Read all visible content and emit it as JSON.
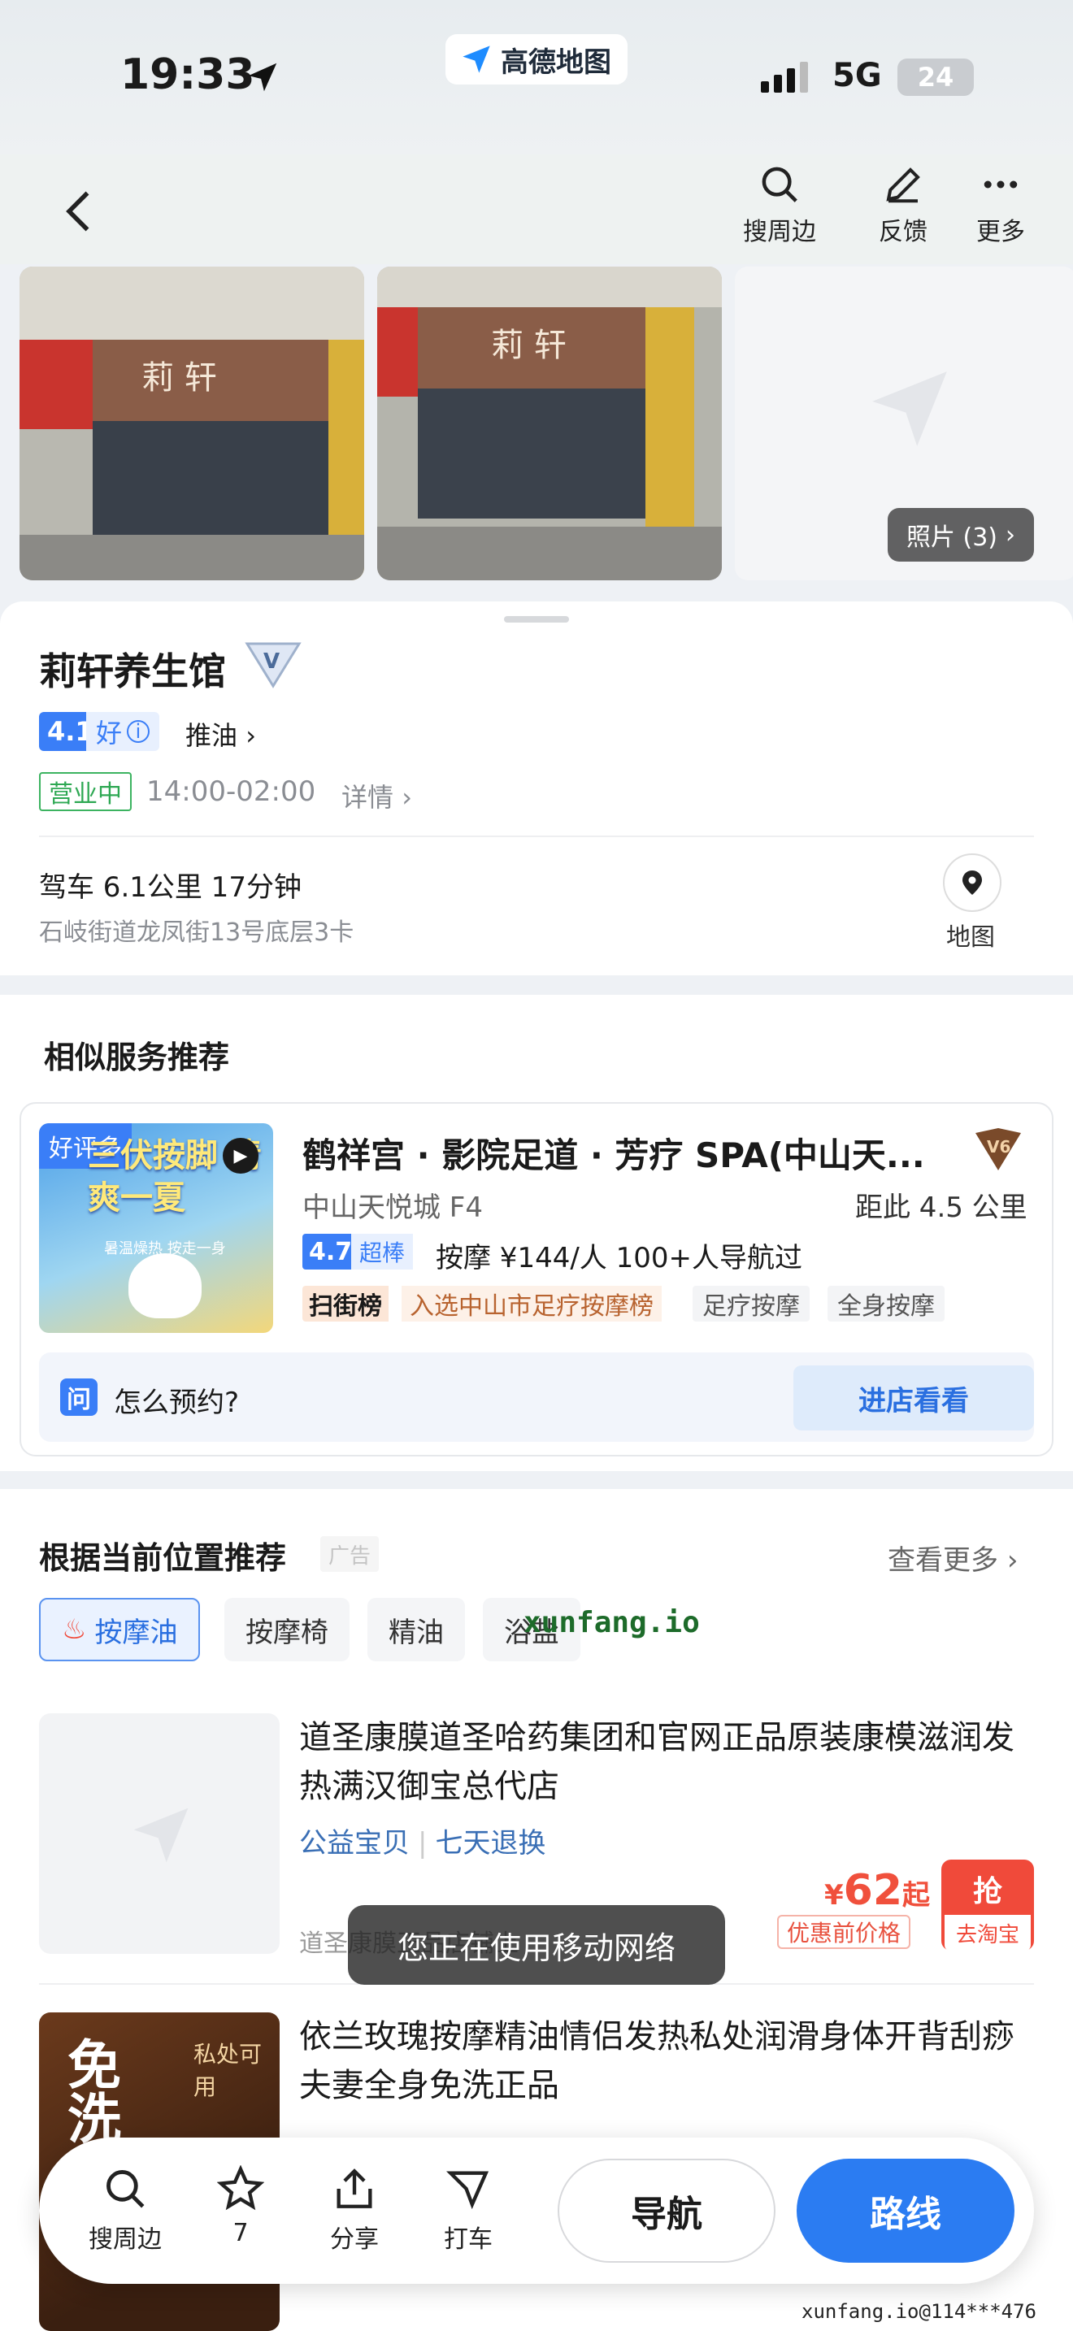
{
  "status": {
    "time": "19:33",
    "app_badge": "高德地图",
    "network": "5G",
    "battery": "24"
  },
  "header": {
    "search_nearby": "搜周边",
    "feedback": "反馈",
    "more": "更多"
  },
  "photos": {
    "count_label": "照片 (3)"
  },
  "poi": {
    "name": "莉轩养生馆",
    "score": "4.1",
    "score_label": "好",
    "tag": "推油",
    "status": "营业中",
    "hours": "14:00-02:00",
    "details": "详情",
    "drive": "驾车 6.1公里 17分钟",
    "address": "石岐街道龙凤街13号底层3卡",
    "map": "地图"
  },
  "similar": {
    "title": "相似服务推荐",
    "image_tag": "好评多",
    "image_heading": "三伏按脚 清爽一夏",
    "image_sub": "暑温燥热 按走一身",
    "name": "鹤祥宫 · 影院足道 · 芳疗 SPA(中山天...",
    "location": "中山天悦城 F4",
    "distance": "距此 4.5 公里",
    "score": "4.7",
    "score_label": "超棒",
    "meta": "按摩  ¥144/人  100+人导航过",
    "rank_badge": "扫街榜",
    "rank_text": "入选中山市足疗按摩榜",
    "chips": [
      "足疗按摩",
      "全身按摩"
    ],
    "ask": "怎么预约?",
    "ask_icon": "问",
    "enter": "进店看看"
  },
  "recommend": {
    "title": "根据当前位置推荐",
    "ad": "广告",
    "more": "查看更多",
    "filters": [
      "按摩油",
      "按摩椅",
      "精油",
      "浴盐"
    ],
    "product1": {
      "title": "道圣康膜道圣哈药集团和官网正品原装康模滋润发热满汉御宝总代店",
      "tag1": "公益宝贝",
      "tag2": "七天退换",
      "price": "62",
      "price_currency": "¥",
      "price_suffix": "起",
      "price_label": "优惠前价格",
      "grab": "抢",
      "grab_sub": "去淘宝",
      "shop": "道圣康膜正品店铺上"
    },
    "product2": {
      "title": "依兰玫瑰按摩精油情侣发热私处润滑身体开背刮痧夫妻全身免洗正品",
      "image_big": "免洗",
      "image_small": "私处可用"
    }
  },
  "toast": "您正在使用移动网络",
  "bottombar": {
    "search": "搜周边",
    "fav": "7",
    "share": "分享",
    "taxi": "打车",
    "navigate": "导航",
    "route": "路线"
  },
  "watermark": {
    "top": "xunfang.io",
    "bottom": "xunfang.io@114***476"
  }
}
